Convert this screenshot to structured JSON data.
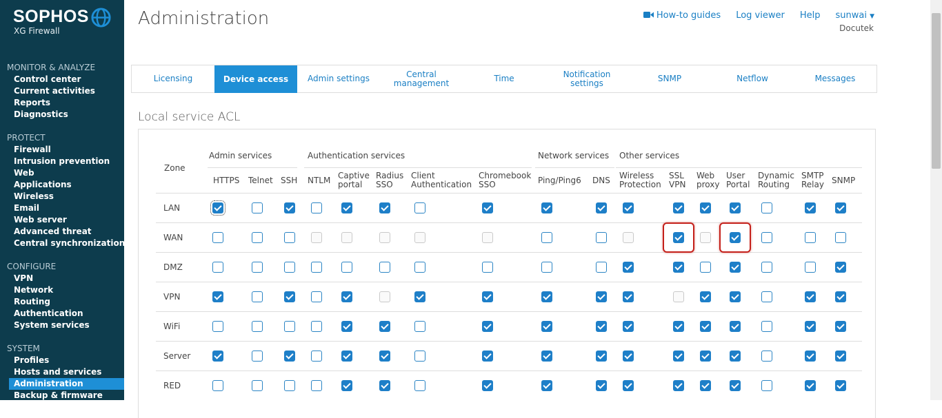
{
  "brand": {
    "name": "SOPHOS",
    "product": "XG Firewall",
    "logo_icon": "globe-icon"
  },
  "sidebar": {
    "sections": [
      {
        "title": "MONITOR & ANALYZE",
        "items": [
          "Control center",
          "Current activities",
          "Reports",
          "Diagnostics"
        ]
      },
      {
        "title": "PROTECT",
        "items": [
          "Firewall",
          "Intrusion prevention",
          "Web",
          "Applications",
          "Wireless",
          "Email",
          "Web server",
          "Advanced threat",
          "Central synchronization"
        ]
      },
      {
        "title": "CONFIGURE",
        "items": [
          "VPN",
          "Network",
          "Routing",
          "Authentication",
          "System services"
        ]
      },
      {
        "title": "SYSTEM",
        "items": [
          "Profiles",
          "Hosts and services",
          "Administration",
          "Backup & firmware"
        ]
      }
    ],
    "active": "Administration"
  },
  "header": {
    "title": "Administration",
    "links": {
      "howto": "How-to guides",
      "howto_icon": "video-camera-icon",
      "logviewer": "Log viewer",
      "help": "Help",
      "user": "sunwai"
    },
    "company": "Docutek"
  },
  "tabs": [
    {
      "label": "Licensing",
      "active": false
    },
    {
      "label": "Device access",
      "active": true
    },
    {
      "label": "Admin settings",
      "active": false
    },
    {
      "label": "Central\nmanagement",
      "active": false
    },
    {
      "label": "Time",
      "active": false
    },
    {
      "label": "Notification\nsettings",
      "active": false
    },
    {
      "label": "SNMP",
      "active": false
    },
    {
      "label": "Netflow",
      "active": false
    },
    {
      "label": "Messages",
      "active": false
    }
  ],
  "acl": {
    "title": "Local service ACL",
    "zone_header": "Zone",
    "groups": [
      "Admin services",
      "Authentication services",
      "Network services",
      "Other services"
    ],
    "columns": [
      "HTTPS",
      "Telnet",
      "SSH",
      "NTLM",
      "Captive\nportal",
      "Radius\nSSO",
      "Client\nAuthentication",
      "Chromebook\nSSO",
      "Ping/Ping6",
      "DNS",
      "Wireless\nProtection",
      "SSL\nVPN",
      "Web\nproxy",
      "User\nPortal",
      "Dynamic\nRouting",
      "SMTP\nRelay",
      "SNMP"
    ],
    "rows": [
      {
        "zone": "LAN",
        "cells": "CUCUCCUCCCCCCCUCC"
      },
      {
        "zone": "WAN",
        "cells": "UUUDDDDDUUDCDCUUU"
      },
      {
        "zone": "DMZ",
        "cells": "UUUUUUUUUUCCUCUUC"
      },
      {
        "zone": "VPN",
        "cells": "CUCUCDCCCCCDCCUCC"
      },
      {
        "zone": "WiFi",
        "cells": "UUUUCCUCCCCCCCUCC"
      },
      {
        "zone": "Server",
        "cells": "CUCUCCUCCCCCCCUCC"
      },
      {
        "zone": "RED",
        "cells": "UUUUCCUCCCCCCCUCC"
      }
    ]
  }
}
